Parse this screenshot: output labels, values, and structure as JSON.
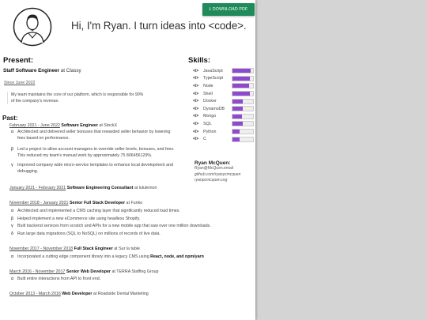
{
  "header": {
    "download_label": "DOWNLOAD PDF",
    "greeting": "Hi, I'm Ryan. I turn ideas into <code>."
  },
  "present": {
    "heading": "Present:",
    "role": "Staff Software Engineer",
    "at": "at",
    "company": "Classy",
    "since": "Since June 2022",
    "desc_1": "My team maintains the core of our platform, which is responsible for 90%",
    "desc_2": "of the company's revenue."
  },
  "skills": {
    "heading": "Skills:",
    "icon_glyph": "</>",
    "bar_color": "#8e49d0",
    "items": [
      {
        "name": "JavaScript",
        "level": 0.88
      },
      {
        "name": "TypeScript",
        "level": 0.85
      },
      {
        "name": "Node",
        "level": 0.8
      },
      {
        "name": "Shell",
        "level": 0.85
      },
      {
        "name": "Docker",
        "level": 0.5
      },
      {
        "name": "DynamoDB",
        "level": 0.5
      },
      {
        "name": "Mongo",
        "level": 0.48
      },
      {
        "name": "SQL",
        "level": 0.5
      },
      {
        "name": "Python",
        "level": 0.35
      },
      {
        "name": "C",
        "level": 0.35
      }
    ]
  },
  "contact": {
    "name": "Ryan McQuen:",
    "email": "Ryan@McQuen.email",
    "github": "github.com/ryanycmcquen",
    "site": "ryanpcmcquen.org"
  },
  "past": {
    "heading": "Past:",
    "jobs": [
      {
        "dates": "February 2021 - June 2022",
        "role": "Software Engineer",
        "company": "StockX",
        "bullets": [
          {
            "glyph": "α",
            "lines": [
              "Architected and delivered seller bonuses that rewarded seller behavior by lowering",
              "fees based on performance."
            ]
          },
          {
            "glyph": "β",
            "lines": [
              "Led a project to allow account managers to override seller levels, bonuses, and fees.",
              "This reduced my team's manual work by approximately 75 806456129%."
            ]
          },
          {
            "glyph": "γ",
            "lines": [
              "Improved company wide micro-service templates to enhance local development and",
              "debugging."
            ]
          }
        ]
      },
      {
        "dates": "January 2021 - February 2021",
        "role": "Software Engineering Consultant",
        "company": "lululemon",
        "bullets": []
      },
      {
        "dates": "November 2018 - January 2021",
        "role": "Senior Full Stack Developer",
        "company": "Funko",
        "bullets": [
          {
            "glyph": "α",
            "lines": [
              "Architected and implemented a CMS caching layer that significantly reduced load times."
            ]
          },
          {
            "glyph": "β",
            "lines": [
              "Helped implement a new eCommerce site using headless Shopify."
            ]
          },
          {
            "glyph": "γ",
            "lines": [
              "Built backend services from scratch and APIs for a new mobile app that saw over one million downloads."
            ]
          },
          {
            "glyph": "δ",
            "lines": [
              "Ran large data migrations (SQL to NoSQL) on millions of records of live data."
            ]
          }
        ]
      },
      {
        "dates": "November 2017 - November 2018",
        "role": "Full Stack Engineer",
        "company": "Sur la table",
        "bullets": [
          {
            "glyph": "α",
            "lines": [
              "Incorporated a cutting edge component library into a legacy CMS using",
              "React, node, and npm/yarn"
            ]
          }
        ]
      },
      {
        "dates": "March 2016 - November 2017",
        "role": "Senior Web Developer",
        "company": "TERRA Staffing Group",
        "bullets": [
          {
            "glyph": "α",
            "lines": [
              "Built entire interactions from API to front end."
            ]
          }
        ]
      },
      {
        "dates": "October 2013 - March 2016",
        "role": "Web Developer",
        "company": "Roadside Dental Marketing",
        "bullets": []
      }
    ]
  }
}
